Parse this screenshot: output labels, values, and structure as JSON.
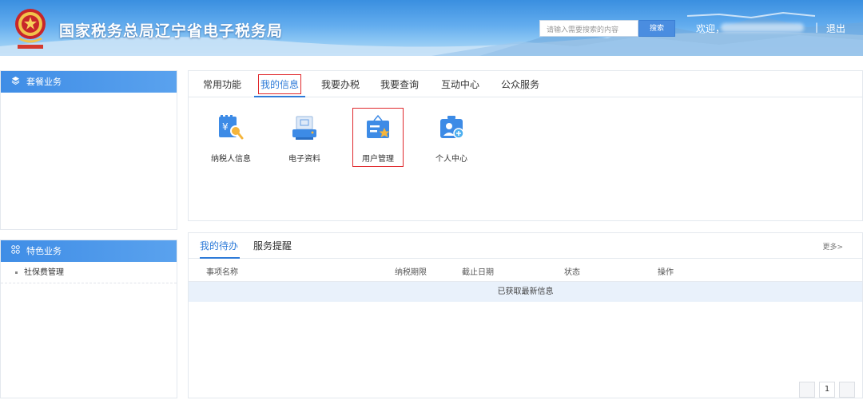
{
  "header": {
    "title": "国家税务总局辽宁省电子税务局",
    "search_placeholder": "请输入需要搜索的内容",
    "search_button": "搜索",
    "welcome": "欢迎，",
    "separator": "|",
    "logout": "退出"
  },
  "sidebar": {
    "package_title": "套餐业务",
    "special_title": "特色业务",
    "special_items": [
      {
        "label": "社保费管理"
      }
    ]
  },
  "main_tabs": [
    {
      "label": "常用功能"
    },
    {
      "label": "我的信息",
      "active": true
    },
    {
      "label": "我要办税"
    },
    {
      "label": "我要查询"
    },
    {
      "label": "互动中心"
    },
    {
      "label": "公众服务"
    }
  ],
  "apps": [
    {
      "label": "纳税人信息",
      "icon": "taxpayer-info-icon"
    },
    {
      "label": "电子资料",
      "icon": "electronic-documents-icon"
    },
    {
      "label": "用户管理",
      "icon": "user-management-icon"
    },
    {
      "label": "个人中心",
      "icon": "personal-center-icon"
    }
  ],
  "task_tabs": [
    {
      "label": "我的待办",
      "active": true
    },
    {
      "label": "服务提醒"
    }
  ],
  "more": "更多>",
  "table": {
    "columns": [
      "事项名称",
      "纳税期限",
      "截止日期",
      "状态",
      "操作"
    ],
    "message": "已获取最新信息"
  },
  "pagination": {
    "current": "1"
  },
  "colors": {
    "accent": "#2e7bd8",
    "highlight": "#e0292d",
    "header_sidebar": "#3f8de6"
  }
}
